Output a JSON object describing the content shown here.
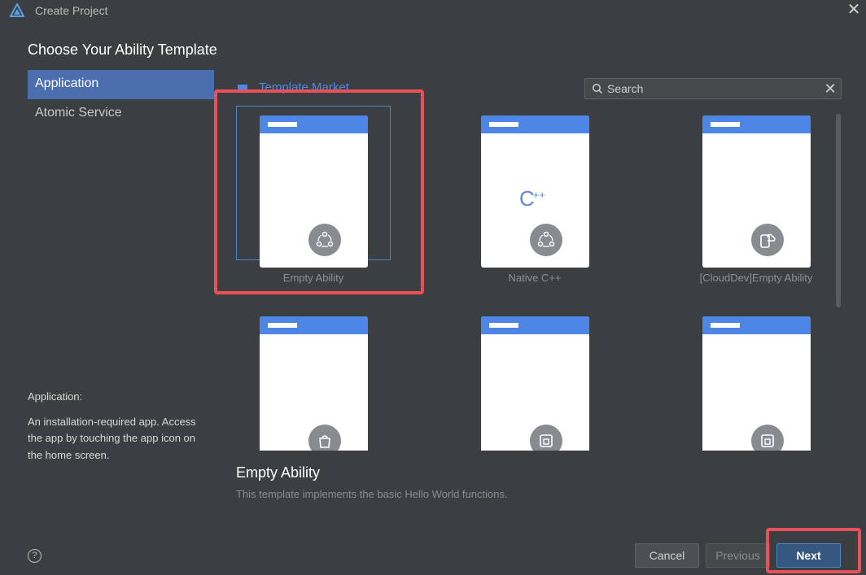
{
  "window": {
    "title": "Create Project",
    "close_glyph": "✕",
    "logo_icon": "app-logo-icon"
  },
  "heading": "Choose Your Ability Template",
  "sidebar": {
    "items": [
      {
        "label": "Application",
        "active": true
      },
      {
        "label": "Atomic Service",
        "active": false
      }
    ]
  },
  "category_description": {
    "title": "Application:",
    "text": "An installation-required app. Access the app by touching the app icon on the home screen."
  },
  "help": {
    "glyph": "?"
  },
  "market": {
    "label": "Template Market",
    "icon": "store-icon"
  },
  "search": {
    "placeholder": "Search",
    "value": "",
    "clear_glyph": "✕"
  },
  "templates": [
    {
      "label": "Empty Ability",
      "selected": true,
      "icon": "ability-icon"
    },
    {
      "label": "Native C++",
      "selected": false,
      "icon": "ability-icon",
      "mark": "C",
      "mark_sup": "++"
    },
    {
      "label": "[CloudDev]Empty Ability",
      "selected": false,
      "icon": "cloud-device-icon"
    },
    {
      "label": "",
      "selected": false,
      "icon": "bag-icon"
    },
    {
      "label": "",
      "selected": false,
      "icon": "device-icon"
    },
    {
      "label": "",
      "selected": false,
      "icon": "device-icon"
    }
  ],
  "selected_template": {
    "title": "Empty Ability",
    "description": "This template implements the basic Hello World functions."
  },
  "buttons": {
    "cancel": "Cancel",
    "previous": "Previous",
    "next": "Next"
  },
  "colors": {
    "accent": "#4b6eaf",
    "highlight": "#e8505b",
    "phone_bar": "#4d86e4"
  }
}
